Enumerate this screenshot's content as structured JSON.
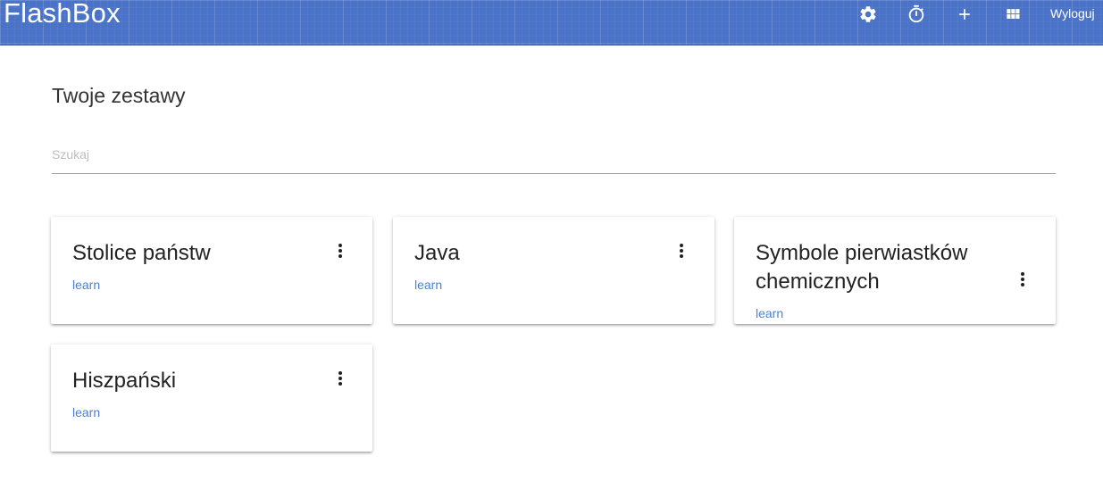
{
  "app": {
    "brand": "FlashBox",
    "nav": {
      "settings_icon": "gear-icon",
      "timer_icon": "stopwatch-icon",
      "add_icon": "plus-icon",
      "grid_icon": "apps-grid-icon",
      "logout_label": "Wyloguj"
    },
    "colors": {
      "header": "#4a72c8",
      "link": "#4a80d8"
    }
  },
  "main": {
    "title": "Twoje zestawy",
    "search": {
      "placeholder": "Szukaj",
      "value": ""
    },
    "sets": [
      {
        "title": "Stolice państw",
        "action": "learn",
        "menu_icon": "more-vert-icon"
      },
      {
        "title": "Java",
        "action": "learn",
        "menu_icon": "more-vert-icon"
      },
      {
        "title": "Symbole pierwiastków chemicznych",
        "action": "learn",
        "menu_icon": "more-vert-icon"
      },
      {
        "title": "Hiszpański",
        "action": "learn",
        "menu_icon": "more-vert-icon"
      }
    ]
  }
}
